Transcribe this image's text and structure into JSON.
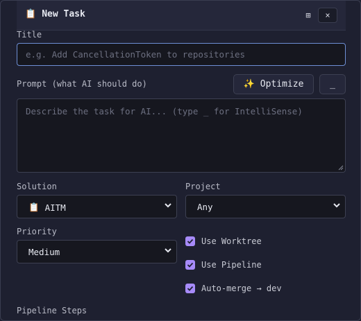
{
  "dialog": {
    "title": "New Task",
    "title_icon": "clipboard-icon",
    "close_label": "×",
    "expand_label": "⊞"
  },
  "form": {
    "title_label": "Title",
    "title_placeholder": "e.g. Add CancellationToken to repositories",
    "prompt_label": "Prompt (what AI should do)",
    "optimize_label": "Optimize",
    "optimize_icon": "sparkles-icon",
    "intellisense_label": "_",
    "prompt_placeholder": "Describe the task for AI... (type _ for IntelliSense)",
    "solution_label": "Solution",
    "solution_value": "AITM",
    "solution_icon": "clipboard-icon",
    "project_label": "Project",
    "project_value": "Any",
    "priority_label": "Priority",
    "priority_value": "Medium",
    "use_worktree_label": "Use Worktree",
    "use_worktree_checked": true,
    "use_pipeline_label": "Use Pipeline",
    "use_pipeline_checked": true,
    "auto_merge_label": "Auto-merge → dev",
    "auto_merge_checked": true,
    "pipeline_steps_label": "Pipeline Steps"
  },
  "colors": {
    "background": "#1e2030",
    "field_bg": "#16171f",
    "focus_border": "#6e8fd6",
    "checkbox_accent": "#a78bfa"
  }
}
